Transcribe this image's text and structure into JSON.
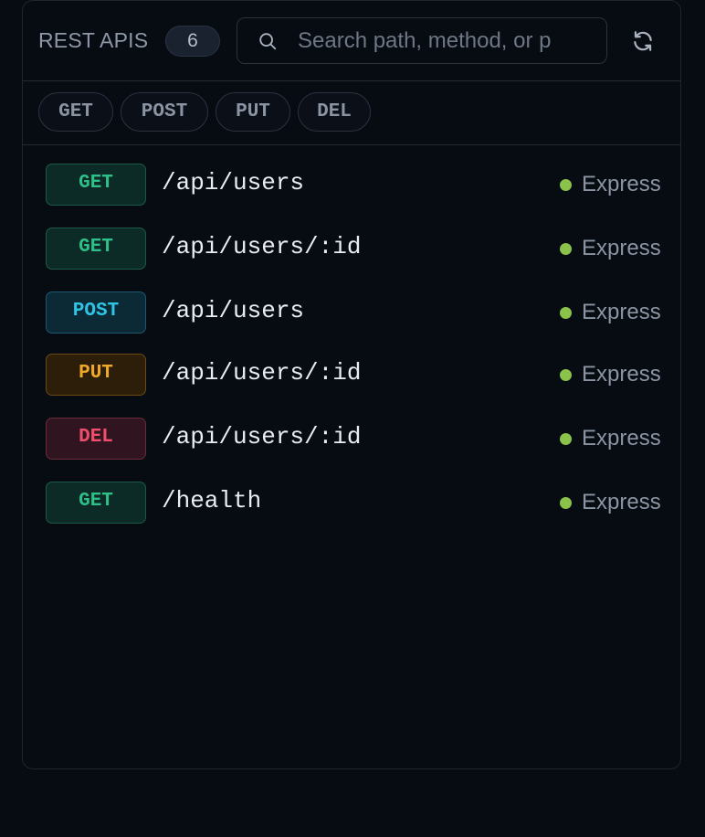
{
  "header": {
    "title": "REST APIS",
    "count": "6",
    "search_placeholder": "Search path, method, or p"
  },
  "filters": [
    "GET",
    "POST",
    "PUT",
    "DEL"
  ],
  "routes": [
    {
      "method": "GET",
      "path": "/api/users",
      "framework": "Express"
    },
    {
      "method": "GET",
      "path": "/api/users/:id",
      "framework": "Express"
    },
    {
      "method": "POST",
      "path": "/api/users",
      "framework": "Express"
    },
    {
      "method": "PUT",
      "path": "/api/users/:id",
      "framework": "Express"
    },
    {
      "method": "DEL",
      "path": "/api/users/:id",
      "framework": "Express"
    },
    {
      "method": "GET",
      "path": "/health",
      "framework": "Express"
    }
  ],
  "colors": {
    "background": "#070b12",
    "get": "#2fbf88",
    "post": "#2ec4e6",
    "put": "#f0a82a",
    "del": "#ef4f6c",
    "status_ok": "#8ac24a"
  },
  "icons": {
    "search": "search-icon",
    "refresh": "refresh-icon"
  }
}
